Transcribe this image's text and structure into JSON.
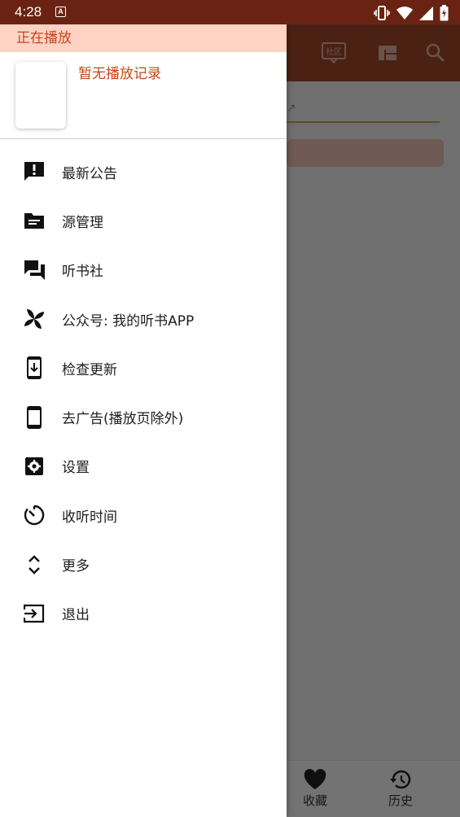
{
  "status_bar": {
    "time": "4:28",
    "notif_letter": "A"
  },
  "drawer": {
    "now_playing_header": "正在播放",
    "now_playing_empty": "暂无播放记录",
    "menu": [
      {
        "label": "最新公告",
        "icon": "announcement-icon"
      },
      {
        "label": "源管理",
        "icon": "folder-icon"
      },
      {
        "label": "听书社",
        "icon": "forum-icon"
      },
      {
        "label": "公众号: 我的听书APP",
        "icon": "pinwheel-icon"
      },
      {
        "label": "检查更新",
        "icon": "phone-update-icon"
      },
      {
        "label": "去广告(播放页除外)",
        "icon": "phone-icon"
      },
      {
        "label": "设置",
        "icon": "settings-icon"
      },
      {
        "label": "收听时间",
        "icon": "timer-icon"
      },
      {
        "label": "更多",
        "icon": "unfold-more-icon"
      },
      {
        "label": "退出",
        "icon": "exit-icon"
      }
    ]
  },
  "background_app": {
    "bottom_nav": [
      {
        "label": "收藏",
        "icon": "heart-icon"
      },
      {
        "label": "历史",
        "icon": "history-icon"
      }
    ],
    "toolbar_badge": "社区"
  },
  "colors": {
    "toolbar": "#a64a2b",
    "status_bar": "#6a2312",
    "accent": "#c8451c",
    "header_bg": "#ffd3c4"
  }
}
